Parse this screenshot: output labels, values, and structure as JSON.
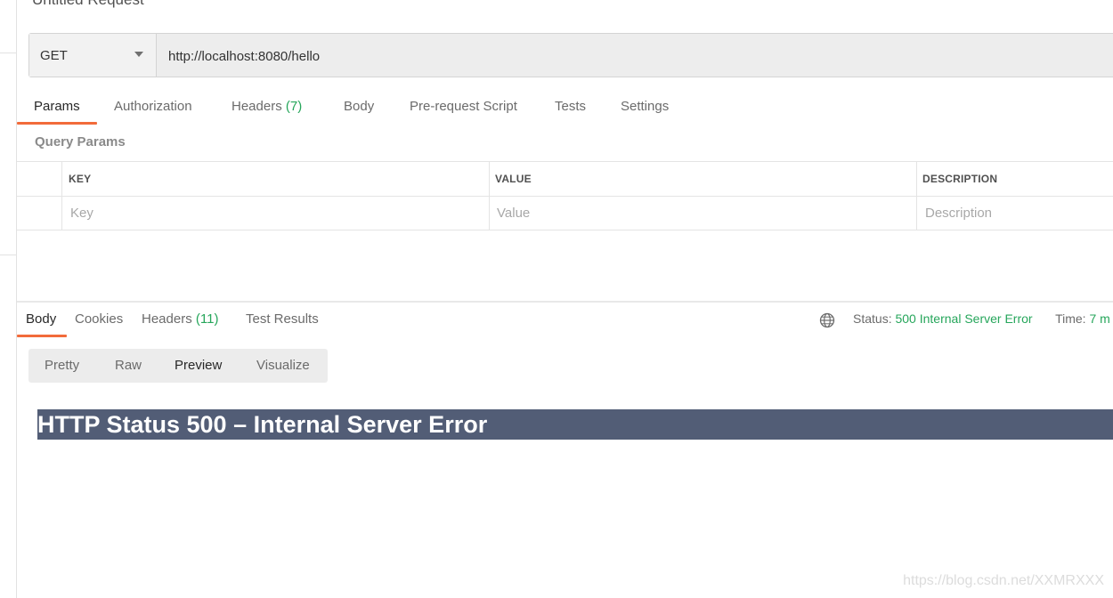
{
  "request": {
    "title": "Untitled Request",
    "method": "GET",
    "url": "http://localhost:8080/hello"
  },
  "request_tabs": [
    {
      "label": "Params",
      "count": ""
    },
    {
      "label": "Authorization",
      "count": ""
    },
    {
      "label": "Headers",
      "count": "(7)"
    },
    {
      "label": "Body",
      "count": ""
    },
    {
      "label": "Pre-request Script",
      "count": ""
    },
    {
      "label": "Tests",
      "count": ""
    },
    {
      "label": "Settings",
      "count": ""
    }
  ],
  "query_params": {
    "section_label": "Query Params",
    "columns": [
      "KEY",
      "VALUE",
      "DESCRIPTION"
    ],
    "placeholders": {
      "key": "Key",
      "value": "Value",
      "description": "Description"
    }
  },
  "response_tabs": [
    {
      "label": "Body",
      "count": ""
    },
    {
      "label": "Cookies",
      "count": ""
    },
    {
      "label": "Headers",
      "count": "(11)"
    },
    {
      "label": "Test Results",
      "count": ""
    }
  ],
  "response_meta": {
    "status_label": "Status:",
    "status_value": "500 Internal Server Error",
    "time_label": "Time:",
    "time_value": "7 m"
  },
  "view_modes": [
    "Pretty",
    "Raw",
    "Preview",
    "Visualize"
  ],
  "preview": {
    "heading": "HTTP Status 500 – Internal Server Error"
  },
  "watermark": "https://blog.csdn.net/XXMRXXX",
  "colors": {
    "accent": "#f26b3a",
    "success": "#26a65b",
    "preview_heading_bg": "#525d76"
  }
}
